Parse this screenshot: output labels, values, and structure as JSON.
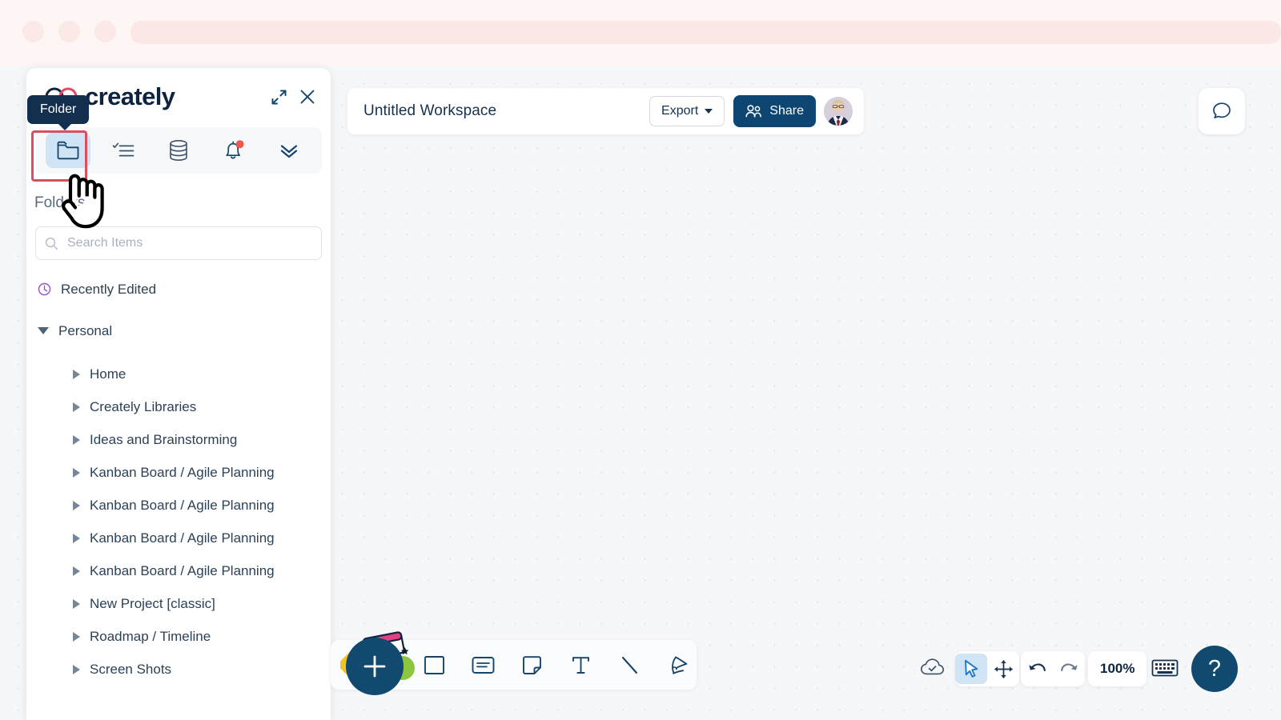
{
  "browser": {
    "dots": [
      "window-close",
      "window-minimize",
      "window-maximize"
    ],
    "urlbar_value": ""
  },
  "panel": {
    "logo_text": "creately",
    "expand_icon": "expand-icon",
    "close_icon": "close-icon",
    "tooltip": "Folder",
    "section_label": "Folders",
    "tabs": [
      {
        "name": "folder",
        "icon": "folder-icon",
        "active": true,
        "badge": false
      },
      {
        "name": "tasks",
        "icon": "checklist-icon",
        "active": false,
        "badge": false
      },
      {
        "name": "data",
        "icon": "database-icon",
        "active": false,
        "badge": false
      },
      {
        "name": "notifications",
        "icon": "bell-icon",
        "active": false,
        "badge": true
      },
      {
        "name": "more",
        "icon": "chevron-double-down-icon",
        "active": false,
        "badge": false
      }
    ],
    "search": {
      "placeholder": "Search Items",
      "value": "",
      "icon": "search-icon"
    },
    "tree": [
      {
        "label": "Recently Edited",
        "level": 0,
        "icon": "clock-icon",
        "expanded": null
      },
      {
        "label": "Personal",
        "level": 0,
        "icon": "caret-down-icon",
        "expanded": true
      },
      {
        "label": "Home",
        "level": 1,
        "icon": "caret-right-icon",
        "expanded": false
      },
      {
        "label": "Creately Libraries",
        "level": 1,
        "icon": "caret-right-icon",
        "expanded": false
      },
      {
        "label": "Ideas and Brainstorming",
        "level": 1,
        "icon": "caret-right-icon",
        "expanded": false
      },
      {
        "label": "Kanban Board / Agile Planning",
        "level": 1,
        "icon": "caret-right-icon",
        "expanded": false
      },
      {
        "label": "Kanban Board / Agile Planning",
        "level": 1,
        "icon": "caret-right-icon",
        "expanded": false
      },
      {
        "label": "Kanban Board / Agile Planning",
        "level": 1,
        "icon": "caret-right-icon",
        "expanded": false
      },
      {
        "label": "Kanban Board / Agile Planning",
        "level": 1,
        "icon": "caret-right-icon",
        "expanded": false
      },
      {
        "label": "New Project [classic]",
        "level": 1,
        "icon": "caret-right-icon",
        "expanded": false
      },
      {
        "label": "Roadmap / Timeline",
        "level": 1,
        "icon": "caret-right-icon",
        "expanded": false
      },
      {
        "label": "Screen Shots",
        "level": 1,
        "icon": "caret-right-icon",
        "expanded": false
      }
    ]
  },
  "workspace": {
    "title": "Untitled Workspace",
    "export_label": "Export",
    "share_label": "Share",
    "share_icon": "people-icon",
    "avatar_name": "user-avatar",
    "chat_icon": "chat-bubble-icon"
  },
  "shape_toolbar": {
    "add_label": "+",
    "tools": [
      {
        "name": "rectangle",
        "icon": "rectangle-icon"
      },
      {
        "name": "card",
        "icon": "card-icon"
      },
      {
        "name": "sticky-note",
        "icon": "sticky-note-icon"
      },
      {
        "name": "text",
        "icon": "text-icon"
      },
      {
        "name": "line",
        "icon": "line-icon"
      },
      {
        "name": "freehand",
        "icon": "freehand-pen-icon"
      }
    ]
  },
  "bottom_right": {
    "cloud_icon": "cloud-saved-icon",
    "select_icon": "cursor-select-icon",
    "pan_icon": "move-pan-icon",
    "undo_icon": "undo-icon",
    "redo_icon": "redo-icon",
    "zoom_level": "100%",
    "keyboard_icon": "keyboard-icon",
    "help_label": "?"
  },
  "colors": {
    "brand_dark": "#11496f",
    "accent_blue": "#cfe4f5",
    "highlight_red": "#d94f5c",
    "tooltip_bg": "#132f4e",
    "badge_red": "#f4564a",
    "chrome_pink": "#fef5f5",
    "canvas_bg": "#f6f7f9"
  }
}
